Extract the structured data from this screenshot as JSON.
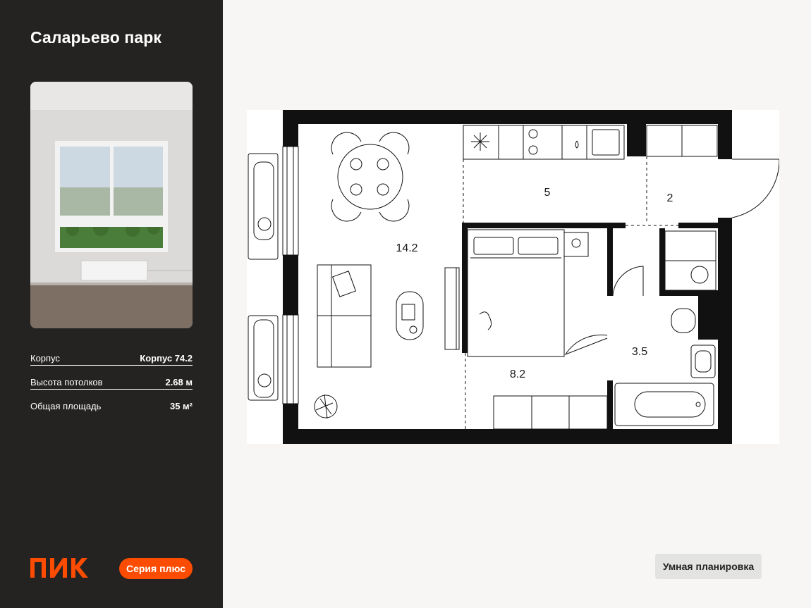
{
  "sidebar": {
    "title": "Саларьево парк",
    "specs": [
      {
        "label": "Корпус",
        "value": "Корпус 74.2"
      },
      {
        "label": "Высота потолков",
        "value": "2.68 м"
      },
      {
        "label": "Общая площадь",
        "value": "35 м²"
      }
    ],
    "logo_text": "ПИК",
    "series_label": "Серия плюс"
  },
  "plan": {
    "rooms": [
      {
        "name": "living",
        "area": "14.2"
      },
      {
        "name": "kitchen",
        "area": "5"
      },
      {
        "name": "hall",
        "area": "2"
      },
      {
        "name": "bedroom",
        "area": "8.2"
      },
      {
        "name": "bathroom",
        "area": "3.5"
      }
    ]
  },
  "smart_plan_label": "Умная планировка",
  "colors": {
    "sidebar_bg": "#242321",
    "accent": "#fc4c02",
    "page_bg": "#f7f6f4",
    "wall": "#111111"
  }
}
